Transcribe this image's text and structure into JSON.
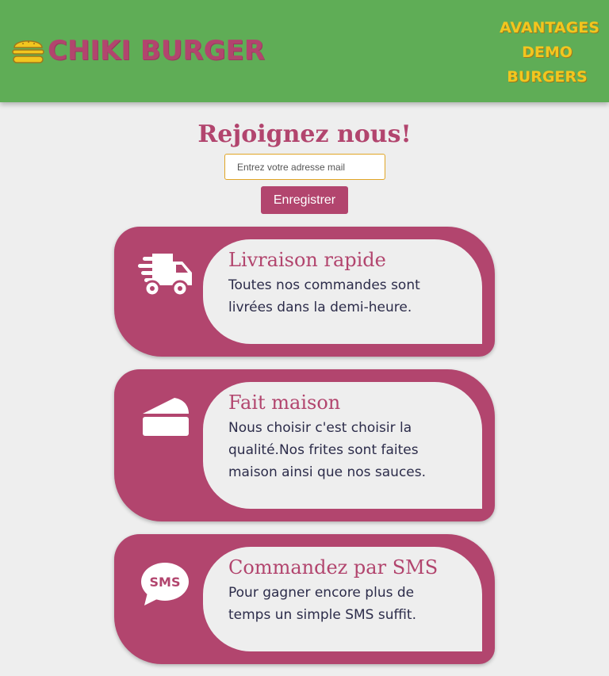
{
  "brand": {
    "name": "CHIKI BURGER",
    "icon": "burger-icon"
  },
  "nav": {
    "items": [
      "AVANTAGES",
      "DEMO",
      "BURGERS"
    ]
  },
  "join": {
    "title": "Rejoignez nous!",
    "email_placeholder": "Entrez votre adresse mail",
    "submit_label": "Enregistrer"
  },
  "features": [
    {
      "icon": "delivery-truck-icon",
      "title": "Livraison rapide",
      "text": "Toutes nos commandes sont livrées dans la demi-heure."
    },
    {
      "icon": "cake-slice-icon",
      "title": "Fait maison",
      "text": "Nous choisir c'est choisir la qualité.Nos frites sont faites maison ainsi que nos sauces."
    },
    {
      "icon": "sms-bubble-icon",
      "title": "Commandez par SMS",
      "text": "Pour gagner encore plus de temps un simple SMS suffit."
    }
  ],
  "colors": {
    "header": "#5fad56",
    "brand": "#b2456e",
    "accent": "#f2c61f",
    "background": "#eeeeee"
  }
}
